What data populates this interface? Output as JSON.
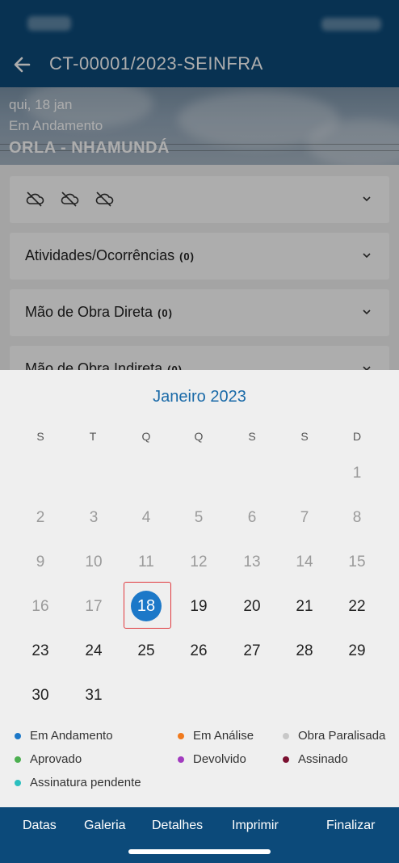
{
  "header": {
    "title": "CT-00001/2023-SEINFRA"
  },
  "hero": {
    "date": "qui, 18 jan",
    "status": "Em Andamento",
    "name": "ORLA - NHAMUNDÁ"
  },
  "sections": [
    {
      "label": "Atividades/Ocorrências",
      "count": "(0)"
    },
    {
      "label": "Mão de Obra Direta",
      "count": "(0)"
    },
    {
      "label": "Mão de Obra Indireta",
      "count": "(0)"
    }
  ],
  "weather": {
    "icons": [
      "cloud-icon",
      "cloud-icon",
      "cloud-icon"
    ]
  },
  "bottom_nav": [
    "Datas",
    "Galeria",
    "Detalhes",
    "Imprimir",
    "Finalizar"
  ],
  "calendar": {
    "month_title": "Janeiro 2023",
    "weekdays": [
      "S",
      "T",
      "Q",
      "Q",
      "S",
      "S",
      "D"
    ],
    "selected_day": "18",
    "weeks": [
      [
        "",
        "",
        "",
        "",
        "",
        "",
        "1"
      ],
      [
        "2",
        "3",
        "4",
        "5",
        "6",
        "7",
        "8"
      ],
      [
        "9",
        "10",
        "11",
        "12",
        "13",
        "14",
        "15"
      ],
      [
        "16",
        "17",
        "18",
        "19",
        "20",
        "21",
        "22"
      ],
      [
        "23",
        "24",
        "25",
        "26",
        "27",
        "28",
        "29"
      ],
      [
        "30",
        "31",
        "",
        "",
        "",
        "",
        ""
      ]
    ],
    "first_enabled_day": 18
  },
  "legend": [
    {
      "label": "Em Andamento",
      "color": "#1c78c8"
    },
    {
      "label": "Em Análise",
      "color": "#f07a1e"
    },
    {
      "label": "Obra Paralisada",
      "color": "#c8c8c8"
    },
    {
      "label": "Aprovado",
      "color": "#4caf50"
    },
    {
      "label": "Devolvido",
      "color": "#a23bbf"
    },
    {
      "label": "Assinado",
      "color": "#7a1030"
    },
    {
      "label": "Assinatura pendente",
      "color": "#2bbfbf"
    }
  ],
  "colors": {
    "primary": "#0c4a7a",
    "accent": "#1c78c8",
    "selection_border": "#e0393e"
  }
}
